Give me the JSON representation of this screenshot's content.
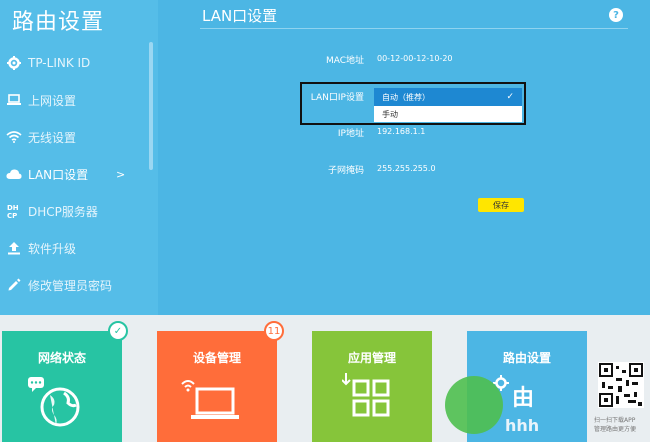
{
  "sidebar": {
    "title": "路由设置",
    "items": [
      {
        "label": "TP-LINK ID",
        "icon": "gear-icon"
      },
      {
        "label": "上网设置",
        "icon": "laptop-icon"
      },
      {
        "label": "无线设置",
        "icon": "wifi-icon"
      },
      {
        "label": "LAN口设置",
        "icon": "cloud-icon",
        "chevron": ">"
      },
      {
        "label": "DHCP服务器",
        "icon": "dhcp-icon"
      },
      {
        "label": "软件升级",
        "icon": "upload-icon"
      },
      {
        "label": "修改管理员密码",
        "icon": "pencil-icon"
      }
    ]
  },
  "main": {
    "title": "LAN口设置",
    "help": "?",
    "mac_label": "MAC地址",
    "mac_value": "00-12-00-12-10-20",
    "lanip_label": "LAN口IP设置",
    "lanip_selected": "自动（推荐）",
    "lanip_option": "手动",
    "ip_label": "IP地址",
    "ip_value": "192.168.1.1",
    "mask_label": "子网掩码",
    "mask_value": "255.255.255.0",
    "save_label": "保存"
  },
  "tiles": [
    {
      "label": "网络状态",
      "color": "#27c4a3",
      "badge": "✓"
    },
    {
      "label": "设备管理",
      "color": "#ff6d3a",
      "badge": "11"
    },
    {
      "label": "应用管理",
      "color": "#86c53a"
    },
    {
      "label": "路由设置",
      "color": "#4cb6e4"
    }
  ],
  "watermark": {
    "text": "由",
    "sub": "hhh",
    "qr_caption_1": "扫一扫下载APP",
    "qr_caption_2": "管理路由更方便"
  }
}
